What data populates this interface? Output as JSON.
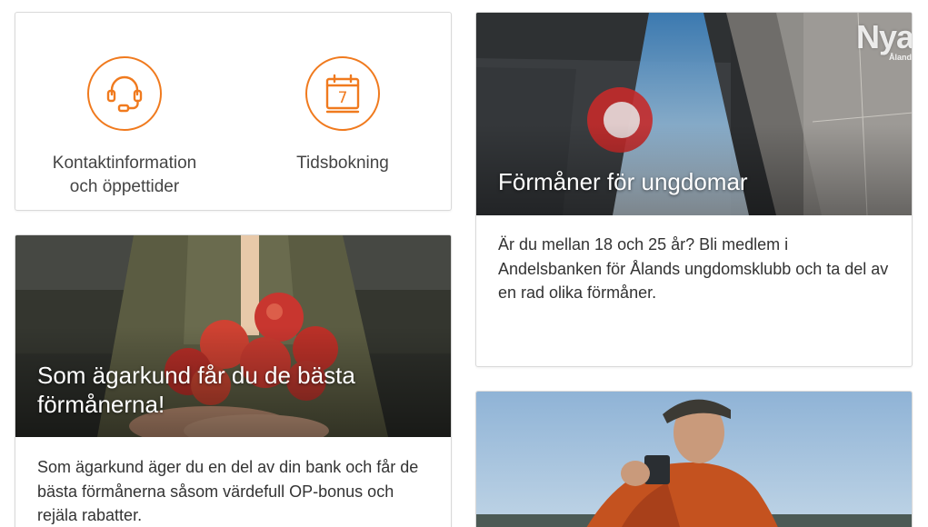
{
  "quick_links": {
    "contact_label": "Kontaktinformation\noch öppettider",
    "booking_label": "Tidsbokning",
    "calendar_day": "7",
    "icon_color": "#f07a1e"
  },
  "youth_card": {
    "title": "Förmåner för ungdomar",
    "text": "Är du mellan 18 och 25 år? Bli medlem i Andelsbanken för Ålands ungdomsklubb och ta del av en rad olika förmåner."
  },
  "owner_card": {
    "title": "Som ägarkund får du de bästa förmånerna!",
    "text": "Som ägarkund äger du en del av din bank och får de bästa förmånerna såsom värdefull OP-bonus och rejäla rabatter."
  },
  "watermark": {
    "main": "Nya",
    "sub": "Åland"
  }
}
